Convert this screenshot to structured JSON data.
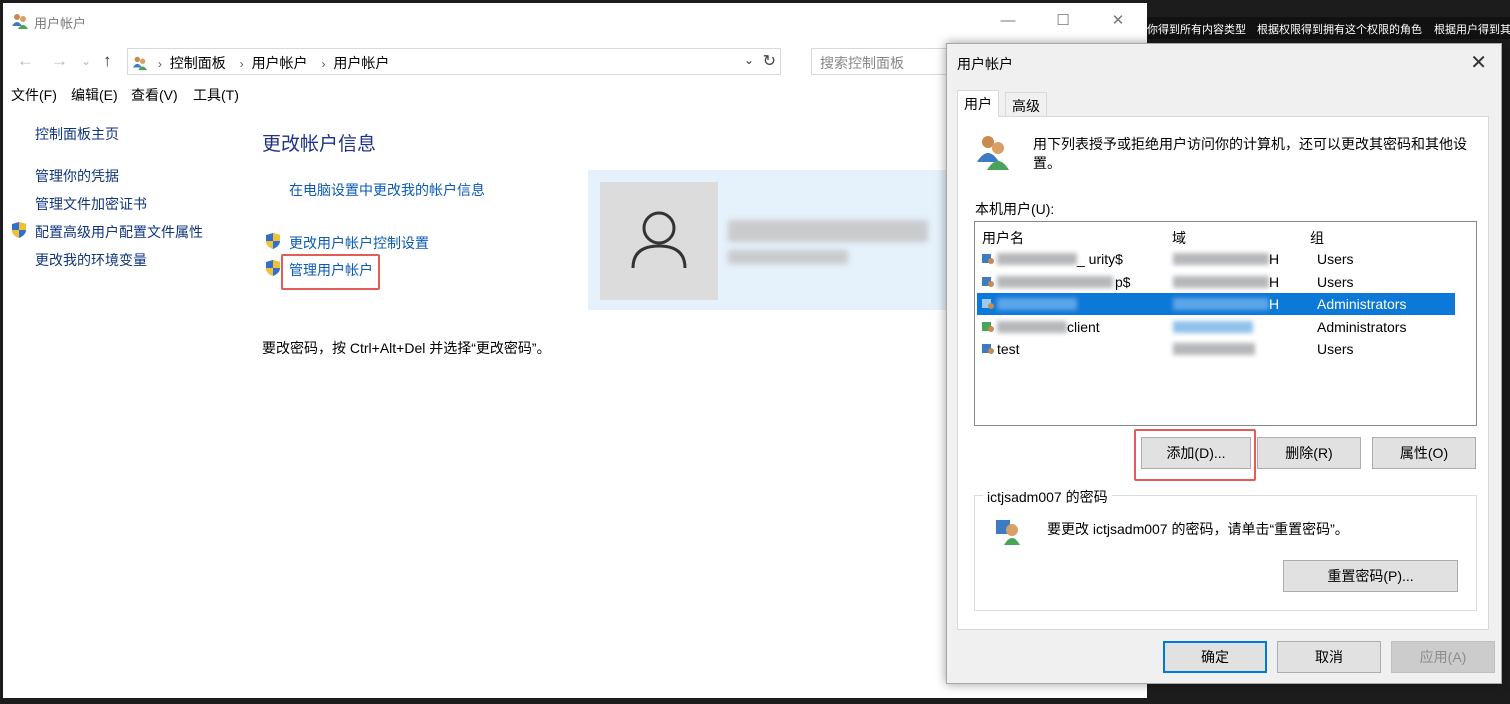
{
  "window": {
    "title": "用户帐户",
    "controls": {
      "minimize": "—",
      "maximize": "☐",
      "close": "✕"
    }
  },
  "address": {
    "breadcrumbs": [
      "控制面板",
      "用户帐户",
      "用户帐户"
    ],
    "search_placeholder": "搜索控制面板"
  },
  "menu": [
    "文件(F)",
    "编辑(E)",
    "查看(V)",
    "工具(T)"
  ],
  "sidebar": {
    "home": "控制面板主页",
    "items": [
      "管理你的凭据",
      "管理文件加密证书",
      "配置高级用户配置文件属性",
      "更改我的环境变量"
    ]
  },
  "content": {
    "title": "更改帐户信息",
    "pc_settings_link": "在电脑设置中更改我的帐户信息",
    "uac_link": "更改用户帐户控制设置",
    "manage_link": "管理用户帐户",
    "password_note": "要改密码，按 Ctrl+Alt+Del 并选择“更改密码”。"
  },
  "background_tabs": [
    "你得到所有内容类型",
    "根据权限得到拥有这个权限的角色",
    "根据用户得到其"
  ],
  "dialog": {
    "title": "用户帐户",
    "tabs": [
      "用户",
      "高级"
    ],
    "intro": "用下列表授予或拒绝用户访问你的计算机，还可以更改其密码和其他设置。",
    "list_label": "本机用户(U):",
    "columns": [
      "用户名",
      "域",
      "组"
    ],
    "rows": [
      {
        "name": "_ urity$",
        "domain": "H",
        "group": "Users"
      },
      {
        "name": "p$",
        "domain": "H",
        "group": "Users"
      },
      {
        "name": "",
        "domain": "H",
        "group": "Administrators"
      },
      {
        "name": "client",
        "domain": "",
        "group": "Administrators"
      },
      {
        "name": "test",
        "domain": "",
        "group": "Users"
      }
    ],
    "buttons": {
      "add": "添加(D)...",
      "remove": "删除(R)",
      "properties": "属性(O)"
    },
    "password_group_label": "ictjsadm007 的密码",
    "password_text": "要更改 ictjsadm007 的密码，请单击“重置密码”。",
    "reset_button": "重置密码(P)...",
    "ok": "确定",
    "cancel": "取消",
    "apply": "应用(A)"
  }
}
